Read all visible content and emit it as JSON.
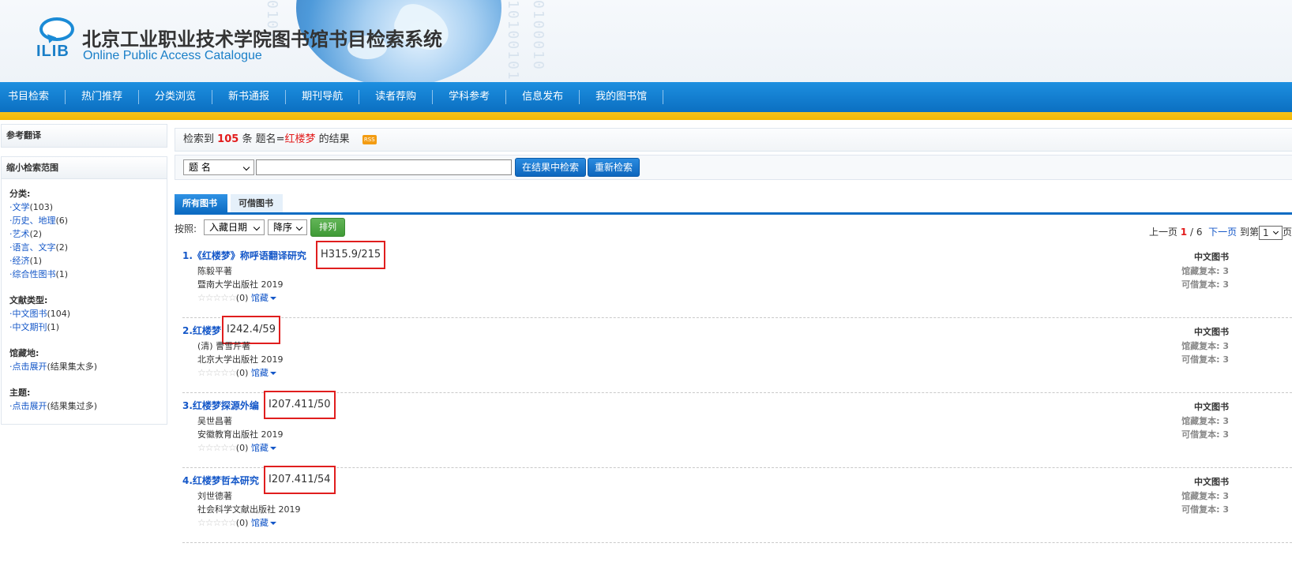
{
  "header": {
    "logo_text": "ILIB",
    "title": "北京工业职业技术学院图书馆书目检索系统",
    "subtitle": "Online Public Access Catalogue"
  },
  "nav": {
    "items": [
      "书目检索",
      "热门推荐",
      "分类浏览",
      "新书通报",
      "期刊导航",
      "读者荐购",
      "学科参考",
      "信息发布",
      "我的图书馆"
    ]
  },
  "sidebar": {
    "reference_title": "参考翻译",
    "narrow_title": "缩小检索范围",
    "category": {
      "label": "分类:",
      "items": [
        {
          "name": "·文学",
          "count": "(103)"
        },
        {
          "name": "·历史、地理",
          "count": "(6)"
        },
        {
          "name": "·艺术",
          "count": "(2)"
        },
        {
          "name": "·语言、文字",
          "count": "(2)"
        },
        {
          "name": "·经济",
          "count": "(1)"
        },
        {
          "name": "·综合性图书",
          "count": "(1)"
        }
      ]
    },
    "doctype": {
      "label": "文献类型:",
      "items": [
        {
          "name": "·中文图书",
          "count": "(104)"
        },
        {
          "name": "·中文期刊",
          "count": "(1)"
        }
      ]
    },
    "location": {
      "label": "馆藏地:",
      "items": [
        {
          "name": "·点击展开",
          "count": "(结果集太多)"
        }
      ]
    },
    "subject": {
      "label": "主题:",
      "items": [
        {
          "name": "·点击展开",
          "count": "(结果集过多)"
        }
      ]
    }
  },
  "result_bar": {
    "prefix": "检索到",
    "count": "105",
    "middle": "条 题名=",
    "keyword": "红楼梦",
    "suffix": "的结果",
    "rss": "RSS"
  },
  "search": {
    "field_selected": "题  名",
    "query": "",
    "within_label": "在结果中检索",
    "new_label": "重新检索"
  },
  "tabs": {
    "all": "所有图书",
    "available": "可借图书"
  },
  "sort": {
    "label": "按照:",
    "by": "入藏日期",
    "order": "降序",
    "button": "排列"
  },
  "pager": {
    "prev": "上一页",
    "current": "1",
    "total": "/ 6",
    "next": "下一页",
    "goto": "到第",
    "page_value": "1",
    "page_suffix": "页"
  },
  "stars": "☆☆☆☆☆",
  "records": [
    {
      "title": "1.《红楼梦》称呼语翻译研究",
      "call_no": "H315.9/215",
      "author": "陈毅平著",
      "publisher": "暨南大学出版社 2019",
      "rating_count": "(0)",
      "holdings": "馆藏",
      "type": "中文图书",
      "copies": "馆藏复本:  3",
      "available": "可借复本:  3"
    },
    {
      "title": "2.红楼梦",
      "call_no": "I242.4/59",
      "author": "(清) 曹雪芹著",
      "publisher": "北京大学出版社 2019",
      "rating_count": "(0)",
      "holdings": "馆藏",
      "type": "中文图书",
      "copies": "馆藏复本:  3",
      "available": "可借复本:  3"
    },
    {
      "title": "3.红楼梦探源外编",
      "call_no": "I207.411/50",
      "author": "吴世昌著",
      "publisher": "安徽教育出版社 2019",
      "rating_count": "(0)",
      "holdings": "馆藏",
      "type": "中文图书",
      "copies": "馆藏复本:  3",
      "available": "可借复本:  3"
    },
    {
      "title": "4.红楼梦哲本研究",
      "call_no": "I207.411/54",
      "author": "刘世德著",
      "publisher": "社会科学文献出版社 2019",
      "rating_count": "(0)",
      "holdings": "馆藏",
      "type": "中文图书",
      "copies": "馆藏复本:  3",
      "available": "可借复本:  3"
    }
  ]
}
